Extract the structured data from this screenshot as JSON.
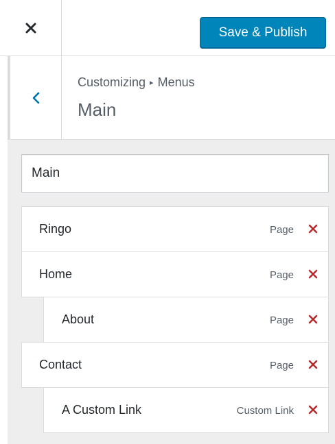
{
  "header": {
    "save_publish_label": "Save & Publish"
  },
  "section": {
    "breadcrumb_parent": "Customizing",
    "breadcrumb_separator": "▸",
    "breadcrumb_current": "Menus",
    "title": "Main"
  },
  "menu_name_input": {
    "value": "Main"
  },
  "menu_items": [
    {
      "title": "Ringo",
      "type": "Page",
      "depth": 0
    },
    {
      "title": "Home",
      "type": "Page",
      "depth": 0
    },
    {
      "title": "About",
      "type": "Page",
      "depth": 1
    },
    {
      "title": "Contact",
      "type": "Page",
      "depth": 0
    },
    {
      "title": "A Custom Link",
      "type": "Custom Link",
      "depth": 1
    }
  ],
  "icons": {
    "close": "close-icon",
    "back": "chevron-left-icon",
    "remove": "remove-x-icon"
  },
  "colors": {
    "primary_button": "#0085ba",
    "remove_icon": "#b32d2e",
    "back_chevron": "#0073aa",
    "panel_background": "#eeeeee"
  }
}
